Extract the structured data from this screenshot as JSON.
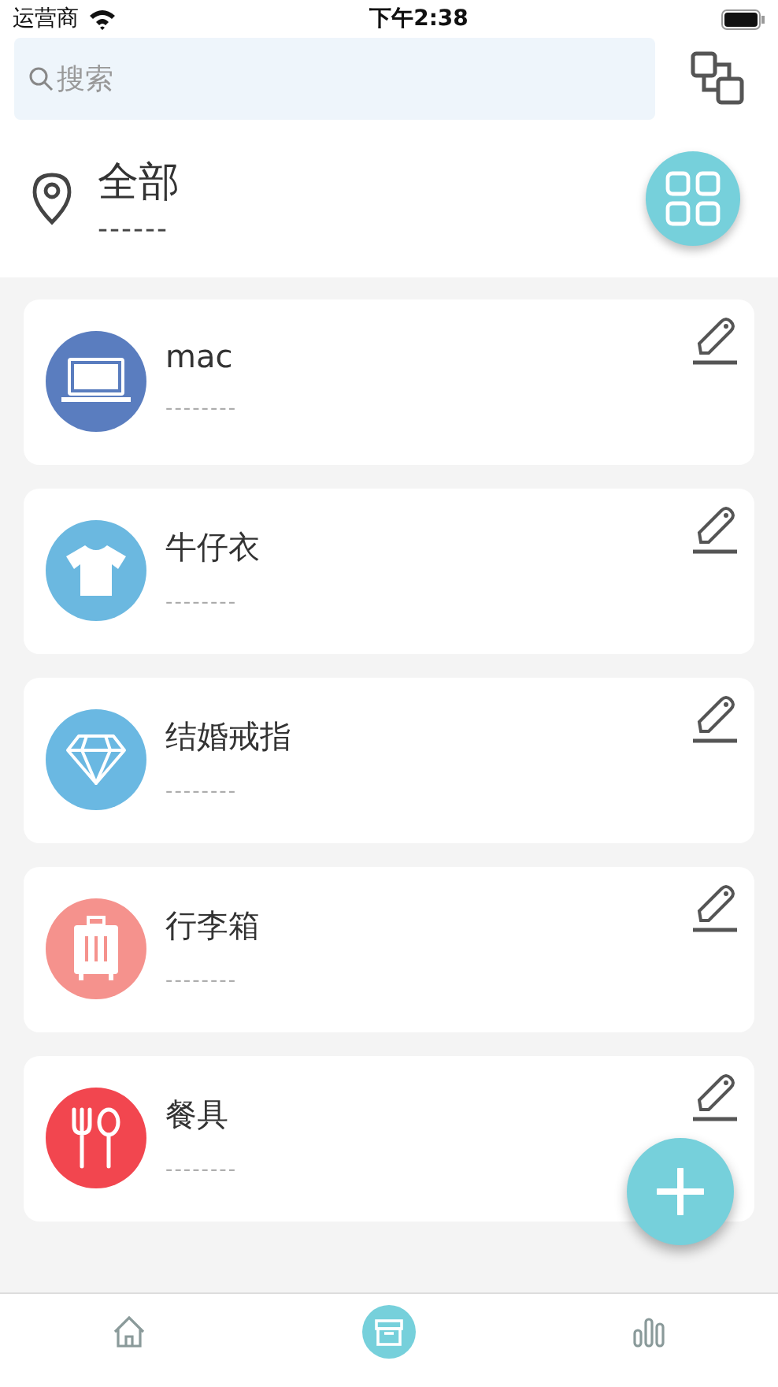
{
  "status_bar": {
    "carrier": "运营商",
    "time": "下午2:38"
  },
  "search": {
    "placeholder": "搜索"
  },
  "location": {
    "title": "全部",
    "subtitle": "------"
  },
  "items": [
    {
      "name": "mac",
      "subtitle": "--------",
      "kind": "laptop",
      "color": "#5a7dbf"
    },
    {
      "name": "牛仔衣",
      "subtitle": "--------",
      "kind": "shirt",
      "color": "#6bb8e0"
    },
    {
      "name": "结婚戒指",
      "subtitle": "--------",
      "kind": "diamond",
      "color": "#6ab8e2"
    },
    {
      "name": "行李箱",
      "subtitle": "--------",
      "kind": "suitcase",
      "color": "#f5928d"
    },
    {
      "name": "餐具",
      "subtitle": "--------",
      "kind": "utensils",
      "color": "#f2464f"
    }
  ],
  "tabs": [
    {
      "kind": "home",
      "selected": false
    },
    {
      "kind": "archive",
      "selected": true
    },
    {
      "kind": "chart",
      "selected": false
    }
  ]
}
